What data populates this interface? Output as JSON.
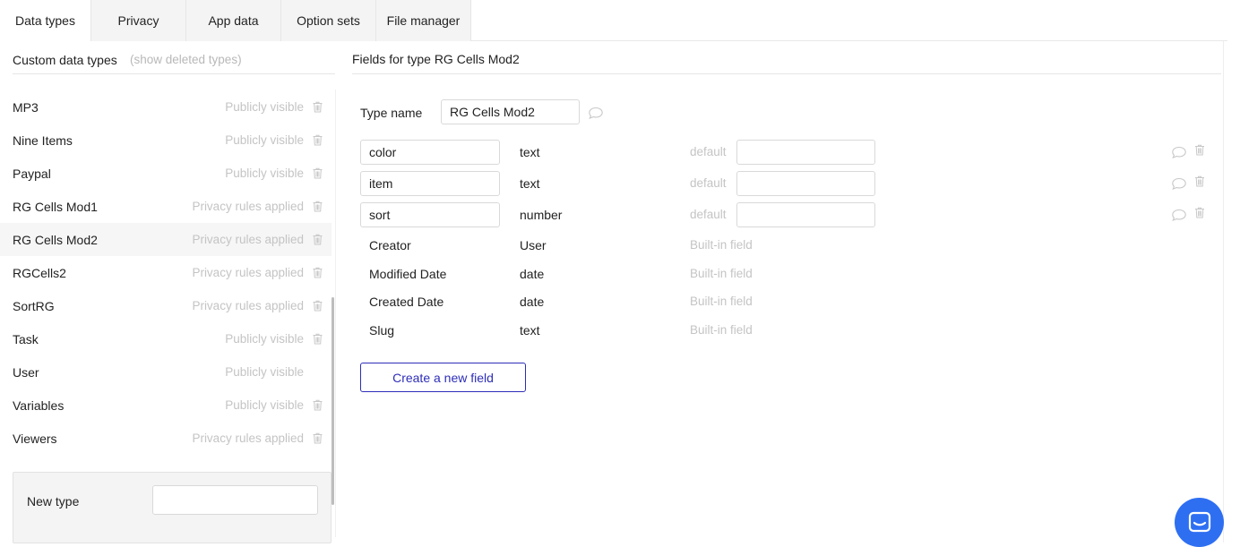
{
  "tabs": [
    {
      "label": "Data types",
      "active": true
    },
    {
      "label": "Privacy",
      "active": false
    },
    {
      "label": "App data",
      "active": false
    },
    {
      "label": "Option sets",
      "active": false
    },
    {
      "label": "File manager",
      "active": false
    }
  ],
  "left": {
    "title": "Custom data types",
    "show_deleted": "(show deleted types)",
    "types": [
      {
        "name": "MP3",
        "status": "Publicly visible",
        "trash": true
      },
      {
        "name": "Nine Items",
        "status": "Publicly visible",
        "trash": true
      },
      {
        "name": "Paypal",
        "status": "Publicly visible",
        "trash": true
      },
      {
        "name": "RG Cells Mod1",
        "status": "Privacy rules applied",
        "trash": true
      },
      {
        "name": "RG Cells Mod2",
        "status": "Privacy rules applied",
        "trash": true,
        "selected": true
      },
      {
        "name": "RGCells2",
        "status": "Privacy rules applied",
        "trash": true
      },
      {
        "name": "SortRG",
        "status": "Privacy rules applied",
        "trash": true
      },
      {
        "name": "Task",
        "status": "Publicly visible",
        "trash": true
      },
      {
        "name": "User",
        "status": "Publicly visible",
        "trash": false
      },
      {
        "name": "Variables",
        "status": "Publicly visible",
        "trash": true
      },
      {
        "name": "Viewers",
        "status": "Privacy rules applied",
        "trash": true
      }
    ],
    "new_type_label": "New type",
    "new_type_value": ""
  },
  "right": {
    "title": "Fields for type RG Cells Mod2",
    "type_name_label": "Type name",
    "type_name_value": "RG Cells Mod2",
    "fields": [
      {
        "name": "color",
        "type": "text",
        "default_label": "default",
        "default_value": ""
      },
      {
        "name": "item",
        "type": "text",
        "default_label": "default",
        "default_value": ""
      },
      {
        "name": "sort",
        "type": "number",
        "default_label": "default",
        "default_value": ""
      }
    ],
    "builtin_fields": [
      {
        "name": "Creator",
        "type": "User",
        "label": "Built-in field"
      },
      {
        "name": "Modified Date",
        "type": "date",
        "label": "Built-in field"
      },
      {
        "name": "Created Date",
        "type": "date",
        "label": "Built-in field"
      },
      {
        "name": "Slug",
        "type": "text",
        "label": "Built-in field"
      }
    ],
    "create_button": "Create a new field"
  },
  "colors": {
    "accent": "#2d2db8",
    "chat": "#2e6ff2",
    "muted_text": "#c4c4c4"
  },
  "icons": {
    "trash": "trash-icon",
    "comment": "comment-icon",
    "chat": "chat-icon"
  }
}
